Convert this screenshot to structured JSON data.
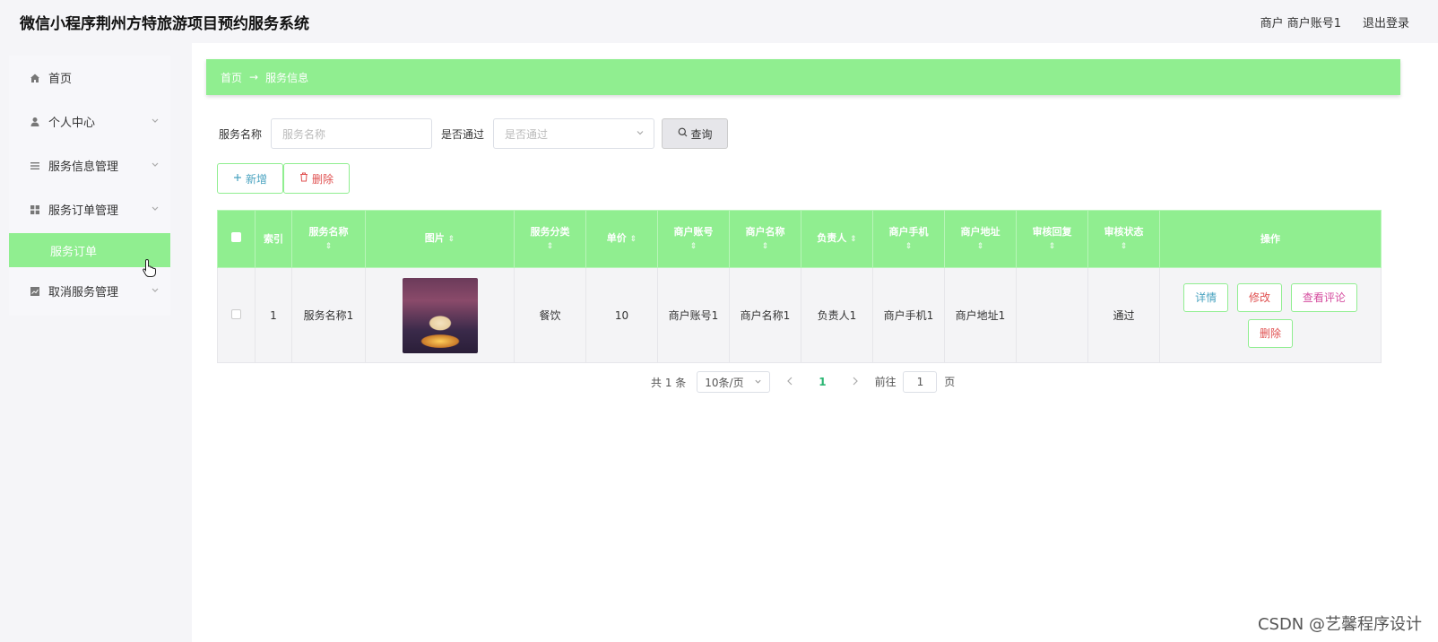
{
  "header": {
    "title": "微信小程序荆州方特旅游项目预约服务系统",
    "user": "商户 商户账号1",
    "logout": "退出登录"
  },
  "sidebar": {
    "items": [
      {
        "label": "首页",
        "icon": "home-icon"
      },
      {
        "label": "个人中心",
        "icon": "user-icon"
      },
      {
        "label": "服务信息管理",
        "icon": "list-icon"
      },
      {
        "label": "服务订单管理",
        "icon": "grid-icon"
      },
      {
        "label": "取消服务管理",
        "icon": "chart-icon"
      }
    ],
    "sub_item": "服务订单"
  },
  "breadcrumb": {
    "home": "首页",
    "arrow": "→",
    "current": "服务信息"
  },
  "search": {
    "name_label": "服务名称",
    "name_placeholder": "服务名称",
    "pass_label": "是否通过",
    "pass_placeholder": "是否通过",
    "query_button": "查询"
  },
  "actions": {
    "add": "新增",
    "delete": "删除"
  },
  "table": {
    "headers": [
      "索引",
      "服务名称",
      "图片",
      "服务分类",
      "单价",
      "商户账号",
      "商户名称",
      "负责人",
      "商户手机",
      "商户地址",
      "审核回复",
      "审核状态",
      "操作"
    ],
    "rows": [
      {
        "index": "1",
        "service_name": "服务名称1",
        "category": "餐饮",
        "price": "10",
        "account": "商户账号1",
        "merchant_name": "商户名称1",
        "person": "负责人1",
        "phone": "商户手机1",
        "address": "商户地址1",
        "reply": "",
        "status": "通过"
      }
    ],
    "ops": {
      "detail": "详情",
      "edit": "修改",
      "comments": "查看评论",
      "delete": "删除"
    }
  },
  "pager": {
    "total": "共 1 条",
    "page_size": "10条/页",
    "current": "1",
    "goto_prefix": "前往",
    "goto_value": "1",
    "goto_suffix": "页"
  },
  "watermark": "CSDN @艺馨程序设计",
  "colors": {
    "accent": "#90ee90",
    "detail_text": "#4aa3c0",
    "edit_text": "#e05050",
    "comment_text": "#d64fa0",
    "delete_text": "#e05050",
    "add_text": "#4aa3c0"
  }
}
